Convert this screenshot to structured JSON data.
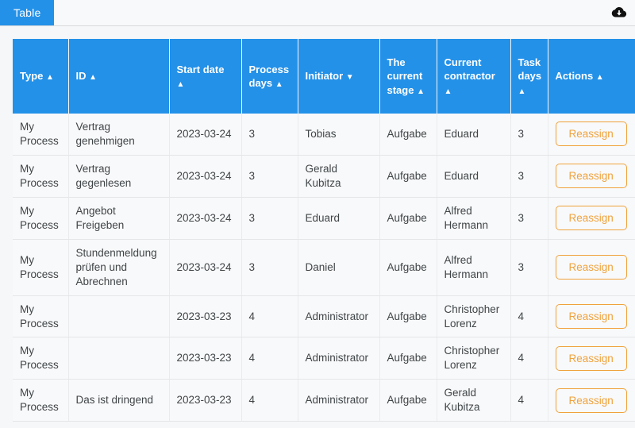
{
  "tabbar": {
    "tab_label": "Table",
    "download_icon": "cloud-download-icon"
  },
  "table": {
    "columns": [
      {
        "label": "Type",
        "sort": "▲"
      },
      {
        "label": "ID",
        "sort": "▲"
      },
      {
        "label": "Start date",
        "sort": "▲"
      },
      {
        "label": "Process days",
        "sort": "▲"
      },
      {
        "label": "Initiator",
        "sort": "▼"
      },
      {
        "label": "The current stage",
        "sort": "▲"
      },
      {
        "label": "Current contractor",
        "sort": "▲"
      },
      {
        "label": "Task days",
        "sort": "▲"
      },
      {
        "label": "Actions",
        "sort": "▲"
      }
    ],
    "action_label": "Reassign",
    "rows": [
      {
        "type": "My Process",
        "id": "Vertrag genehmigen",
        "start_date": "2023-03-24",
        "process_days": "3",
        "initiator": "Tobias",
        "stage": "Aufgabe",
        "contractor": "Eduard",
        "task_days": "3",
        "action": "Reassign"
      },
      {
        "type": "My Process",
        "id": "Vertrag gegenlesen",
        "start_date": "2023-03-24",
        "process_days": "3",
        "initiator": "Gerald Kubitza",
        "stage": "Aufgabe",
        "contractor": "Eduard",
        "task_days": "3",
        "action": "Reassign"
      },
      {
        "type": "My Process",
        "id": "Angebot Freigeben",
        "start_date": "2023-03-24",
        "process_days": "3",
        "initiator": "Eduard",
        "stage": "Aufgabe",
        "contractor": "Alfred Hermann",
        "task_days": "3",
        "action": "Reassign"
      },
      {
        "type": "My Process",
        "id": "Stundenmeldung prüfen und Abrechnen",
        "start_date": "2023-03-24",
        "process_days": "3",
        "initiator": "Daniel",
        "stage": "Aufgabe",
        "contractor": "Alfred Hermann",
        "task_days": "3",
        "action": "Reassign"
      },
      {
        "type": "My Process",
        "id": "",
        "start_date": "2023-03-23",
        "process_days": "4",
        "initiator": "Administrator",
        "stage": "Aufgabe",
        "contractor": "Christopher Lorenz",
        "task_days": "4",
        "action": "Reassign"
      },
      {
        "type": "My Process",
        "id": "",
        "start_date": "2023-03-23",
        "process_days": "4",
        "initiator": "Administrator",
        "stage": "Aufgabe",
        "contractor": "Christopher Lorenz",
        "task_days": "4",
        "action": "Reassign"
      },
      {
        "type": "My Process",
        "id": "Das ist dringend",
        "start_date": "2023-03-23",
        "process_days": "4",
        "initiator": "Administrator",
        "stage": "Aufgabe",
        "contractor": "Gerald Kubitza",
        "task_days": "4",
        "action": "Reassign"
      }
    ]
  },
  "colors": {
    "header_blue": "#2491e8",
    "accent_orange": "#f0a23c",
    "number_green": "#13a10e",
    "page_background": "#f6f7f8"
  }
}
